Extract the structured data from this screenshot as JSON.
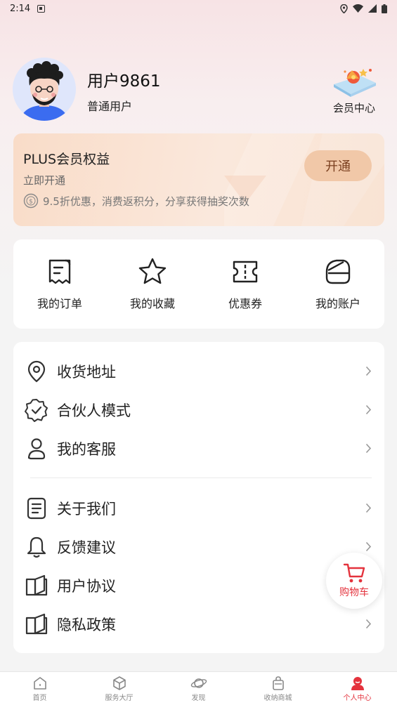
{
  "status_bar": {
    "time": "2:14"
  },
  "profile": {
    "username": "用户9861",
    "user_type": "普通用户",
    "vip_center_label": "会员中心"
  },
  "plus_card": {
    "title": "PLUS会员权益",
    "subtitle": "立即开通",
    "benefit": "9.5折优惠，消费返积分，分享获得抽奖次数",
    "open_button": "开通"
  },
  "quick_actions": [
    {
      "label": "我的订单",
      "icon": "receipt-icon"
    },
    {
      "label": "我的收藏",
      "icon": "star-icon"
    },
    {
      "label": "优惠券",
      "icon": "coupon-icon"
    },
    {
      "label": "我的账户",
      "icon": "wallet-icon"
    }
  ],
  "menu": [
    {
      "label": "收货地址",
      "icon": "location-pin-icon"
    },
    {
      "label": "合伙人模式",
      "icon": "verified-badge-icon"
    },
    {
      "label": "我的客服",
      "icon": "person-icon"
    },
    {
      "label": "关于我们",
      "icon": "document-icon"
    },
    {
      "label": "反馈建议",
      "icon": "bell-icon"
    },
    {
      "label": "用户协议",
      "icon": "book-icon"
    },
    {
      "label": "隐私政策",
      "icon": "book-icon"
    }
  ],
  "cart_fab": {
    "label": "购物车"
  },
  "bottom_nav": [
    {
      "label": "首页",
      "icon": "home-icon",
      "active": false
    },
    {
      "label": "服务大厅",
      "icon": "cube-icon",
      "active": false
    },
    {
      "label": "发现",
      "icon": "planet-icon",
      "active": false
    },
    {
      "label": "收纳商城",
      "icon": "bag-icon",
      "active": false
    },
    {
      "label": "个人中心",
      "icon": "user-profile-icon",
      "active": true
    }
  ],
  "colors": {
    "accent": "#e4333d",
    "plus_button": "#f1c8a8",
    "plus_button_text": "#7a3f1f"
  }
}
